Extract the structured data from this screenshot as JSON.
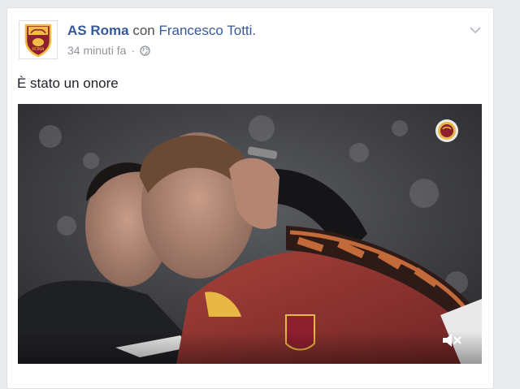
{
  "post": {
    "author": "AS Roma",
    "connector": "con",
    "tagged": "Francesco Totti.",
    "timestamp": "34 minuti fa",
    "separator": "·",
    "text": "È stato un onore"
  },
  "video": {
    "muted": true
  },
  "colors": {
    "link": "#365899",
    "meta": "#90949c",
    "roma_red": "#8e1f2f",
    "roma_gold": "#f0bc42"
  },
  "icons": {
    "avatar": "as-roma-logo-icon",
    "privacy": "globe-icon",
    "menu": "chevron-down-icon",
    "sound": "mute-icon",
    "watermark": "roma-watermark-icon"
  }
}
